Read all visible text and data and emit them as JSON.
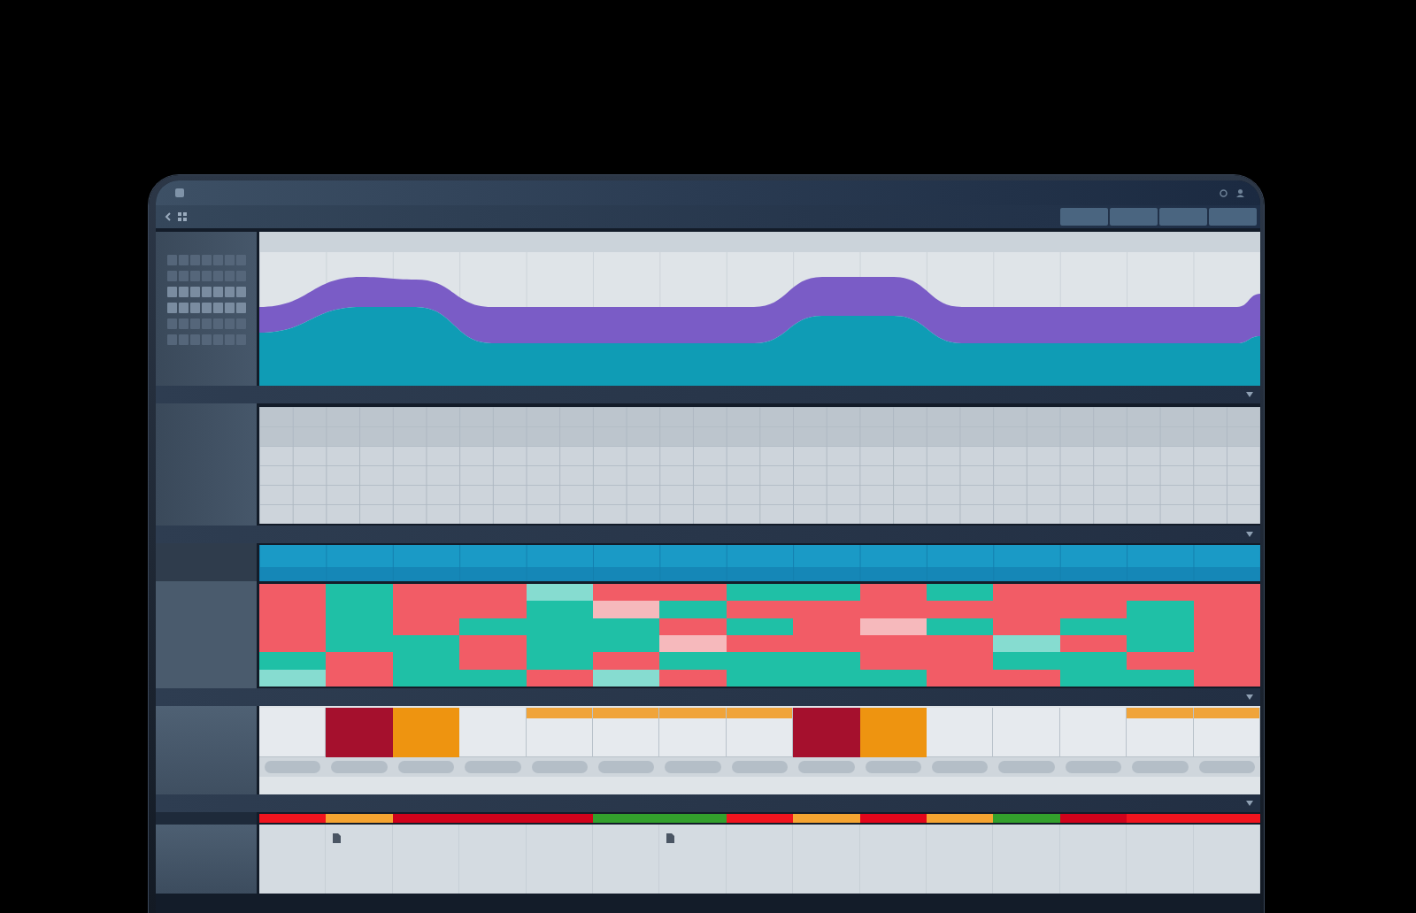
{
  "heatmap": {
    "columns": [
      {
        "cells": [
          {
            "color": "#f25c66"
          },
          {
            "color": "#f25c66"
          },
          {
            "color": "#f25c66"
          },
          {
            "color": "#f25c66"
          },
          {
            "color": "#1fc0a6"
          },
          {
            "color": "#86dcd0"
          }
        ]
      },
      {
        "cells": [
          {
            "color": "#1fc0a6"
          },
          {
            "color": "#1fc0a6"
          },
          {
            "color": "#1fc0a6"
          },
          {
            "color": "#1fc0a6"
          },
          {
            "color": "#f25c66"
          },
          {
            "color": "#f25c66"
          }
        ]
      },
      {
        "cells": [
          {
            "color": "#f25c66"
          },
          {
            "color": "#f25c66"
          },
          {
            "color": "#f25c66"
          },
          {
            "color": "#1fc0a6"
          },
          {
            "color": "#1fc0a6"
          },
          {
            "color": "#1fc0a6"
          }
        ]
      },
      {
        "cells": [
          {
            "color": "#f25c66"
          },
          {
            "color": "#f25c66"
          },
          {
            "color": "#1fc0a6"
          },
          {
            "color": "#f25c66"
          },
          {
            "color": "#f25c66"
          },
          {
            "color": "#1fc0a6"
          }
        ]
      },
      {
        "cells": [
          {
            "color": "#86dcd0"
          },
          {
            "color": "#1fc0a6"
          },
          {
            "color": "#1fc0a6"
          },
          {
            "color": "#1fc0a6"
          },
          {
            "color": "#1fc0a6"
          },
          {
            "color": "#f25c66"
          }
        ]
      },
      {
        "cells": [
          {
            "color": "#f25c66"
          },
          {
            "color": "#f6b9bc"
          },
          {
            "color": "#1fc0a6"
          },
          {
            "color": "#1fc0a6"
          },
          {
            "color": "#f25c66"
          },
          {
            "color": "#86dcd0"
          }
        ]
      },
      {
        "cells": [
          {
            "color": "#f25c66"
          },
          {
            "color": "#1fc0a6"
          },
          {
            "color": "#f25c66"
          },
          {
            "color": "#f6b9bc"
          },
          {
            "color": "#1fc0a6"
          },
          {
            "color": "#f25c66"
          }
        ]
      },
      {
        "cells": [
          {
            "color": "#1fc0a6"
          },
          {
            "color": "#f25c66"
          },
          {
            "color": "#1fc0a6"
          },
          {
            "color": "#f25c66"
          },
          {
            "color": "#1fc0a6"
          },
          {
            "color": "#1fc0a6"
          }
        ]
      },
      {
        "cells": [
          {
            "color": "#1fc0a6"
          },
          {
            "color": "#f25c66"
          },
          {
            "color": "#f25c66"
          },
          {
            "color": "#f25c66"
          },
          {
            "color": "#1fc0a6"
          },
          {
            "color": "#1fc0a6"
          }
        ]
      },
      {
        "cells": [
          {
            "color": "#f25c66"
          },
          {
            "color": "#f25c66"
          },
          {
            "color": "#f6b9bc"
          },
          {
            "color": "#f25c66"
          },
          {
            "color": "#f25c66"
          },
          {
            "color": "#1fc0a6"
          }
        ]
      },
      {
        "cells": [
          {
            "color": "#1fc0a6"
          },
          {
            "color": "#f25c66"
          },
          {
            "color": "#1fc0a6"
          },
          {
            "color": "#f25c66"
          },
          {
            "color": "#f25c66"
          },
          {
            "color": "#f25c66"
          }
        ]
      },
      {
        "cells": [
          {
            "color": "#f25c66"
          },
          {
            "color": "#f25c66"
          },
          {
            "color": "#f25c66"
          },
          {
            "color": "#86dcd0"
          },
          {
            "color": "#1fc0a6"
          },
          {
            "color": "#f25c66"
          }
        ]
      },
      {
        "cells": [
          {
            "color": "#f25c66"
          },
          {
            "color": "#f25c66"
          },
          {
            "color": "#1fc0a6"
          },
          {
            "color": "#f25c66"
          },
          {
            "color": "#1fc0a6"
          },
          {
            "color": "#1fc0a6"
          }
        ]
      },
      {
        "cells": [
          {
            "color": "#f25c66"
          },
          {
            "color": "#1fc0a6"
          },
          {
            "color": "#1fc0a6"
          },
          {
            "color": "#1fc0a6"
          },
          {
            "color": "#f25c66"
          },
          {
            "color": "#1fc0a6"
          }
        ]
      },
      {
        "cells": [
          {
            "color": "#f25c66"
          },
          {
            "color": "#f25c66"
          },
          {
            "color": "#f25c66"
          },
          {
            "color": "#f25c66"
          },
          {
            "color": "#f25c66"
          },
          {
            "color": "#f25c66"
          }
        ]
      }
    ]
  },
  "status_row": [
    {
      "kind": "plain"
    },
    {
      "kind": "block",
      "color": "#a5102d"
    },
    {
      "kind": "block",
      "color": "#ee9410"
    },
    {
      "kind": "plain"
    },
    {
      "kind": "strip",
      "color": "#f0a43a"
    },
    {
      "kind": "strip",
      "color": "#f0a43a"
    },
    {
      "kind": "strip",
      "color": "#f0a43a"
    },
    {
      "kind": "strip",
      "color": "#f0a43a"
    },
    {
      "kind": "block",
      "color": "#a5102d"
    },
    {
      "kind": "block",
      "color": "#ee9410"
    },
    {
      "kind": "plain"
    },
    {
      "kind": "plain"
    },
    {
      "kind": "plain"
    },
    {
      "kind": "strip",
      "color": "#f0a43a"
    },
    {
      "kind": "strip",
      "color": "#f0a43a"
    }
  ],
  "timeline": [
    {
      "color": "#f0141e"
    },
    {
      "color": "#f5a431"
    },
    {
      "color": "#d0021b"
    },
    {
      "color": "#d0021b"
    },
    {
      "color": "#d0021b"
    },
    {
      "color": "#33a02c"
    },
    {
      "color": "#33a02c"
    },
    {
      "color": "#f0141e"
    },
    {
      "color": "#f5a431"
    },
    {
      "color": "#e3061b"
    },
    {
      "color": "#f5a431"
    },
    {
      "color": "#33a02c"
    },
    {
      "color": "#d0021b"
    },
    {
      "color": "#f0141e"
    },
    {
      "color": "#f0141e"
    }
  ],
  "events": [
    {
      "marker": false
    },
    {
      "marker": true
    },
    {
      "marker": false
    },
    {
      "marker": false
    },
    {
      "marker": false
    },
    {
      "marker": false
    },
    {
      "marker": true
    },
    {
      "marker": false
    },
    {
      "marker": false
    },
    {
      "marker": false
    },
    {
      "marker": false
    },
    {
      "marker": false
    },
    {
      "marker": false
    },
    {
      "marker": false
    },
    {
      "marker": false
    }
  ]
}
